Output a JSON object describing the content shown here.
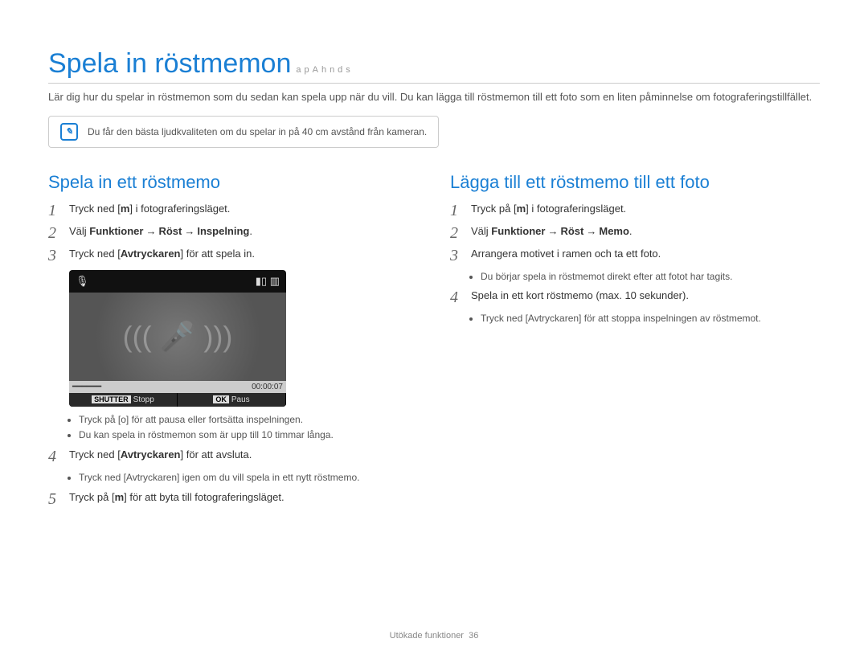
{
  "title": "Spela in röstmemon",
  "title_badges": "apAhnds",
  "intro": "Lär dig hur du spelar in röstmemon som du sedan kan spela upp när du vill. Du kan lägga till röstmemon till ett foto som en liten påminnelse om fotograferingstillfället.",
  "tip": "Du får den bästa ljudkvaliteten om du spelar in på 40 cm avstånd från kameran.",
  "left": {
    "heading": "Spela in ett röstmemo",
    "steps": [
      {
        "num": "1",
        "text_a": "Tryck ned [",
        "bold": "m",
        "text_b": "] i fotograferingsläget."
      },
      {
        "num": "2",
        "text_a": "Välj ",
        "seq": [
          "Funktioner",
          "Röst",
          "Inspelning"
        ],
        "text_b": "."
      },
      {
        "num": "3",
        "text_a": "Tryck ned [",
        "bold": "Avtryckaren",
        "text_b": "] för att spela in."
      },
      {
        "num": "4",
        "text_a": "Tryck ned [",
        "bold": "Avtryckaren",
        "text_b": "] för att avsluta."
      },
      {
        "num": "5",
        "text_a": "Tryck på [",
        "bold": "m",
        "text_b": "] för att byta till fotograferingsläget."
      }
    ],
    "bullets_after_screen": [
      "Tryck på [o] för att pausa eller fortsätta inspelningen.",
      "Du kan spela in röstmemon som är upp till 10 timmar långa."
    ],
    "bullets_after_step4": [
      "Tryck ned [Avtryckaren] igen om du vill spela in ett nytt röstmemo."
    ],
    "screen": {
      "top_left_icon": "mic-icon",
      "top_right_icon": "battery-icon",
      "center_icon": "microphone-big-icon",
      "timecode": "00:00:07",
      "shutter_label": "SHUTTER",
      "shutter_action": "Stopp",
      "ok_label": "OK",
      "ok_action": "Paus"
    }
  },
  "right": {
    "heading": "Lägga till ett röstmemo till ett foto",
    "steps": [
      {
        "num": "1",
        "text_a": "Tryck på [",
        "bold": "m",
        "text_b": "] i fotograferingsläget."
      },
      {
        "num": "2",
        "text_a": "Välj ",
        "seq": [
          "Funktioner",
          "Röst",
          "Memo"
        ],
        "text_b": "."
      },
      {
        "num": "3",
        "text_a": "Arrangera motivet i ramen och ta ett foto.",
        "bullets": [
          "Du börjar spela in röstmemot direkt efter att fotot har tagits."
        ]
      },
      {
        "num": "4",
        "text_a": "Spela in ett kort röstmemo (max. 10 sekunder).",
        "bullets": [
          "Tryck ned [Avtryckaren] för att stoppa inspelningen av röstmemot."
        ]
      }
    ]
  },
  "footer_label": "Utökade funktioner",
  "footer_page": "36"
}
